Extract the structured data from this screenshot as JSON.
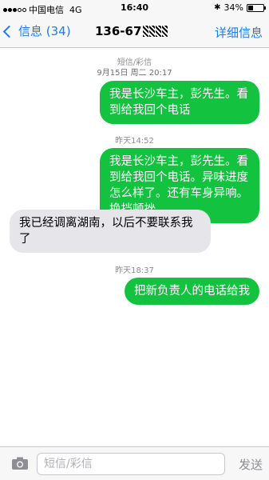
{
  "status_bar": {
    "carrier": "中国电信",
    "network": "4G",
    "time": "16:40",
    "battery": "34%",
    "battery_level": 0.34
  },
  "nav": {
    "back_label": "信息 (34)",
    "title": "136-67",
    "details_label": "详细信息"
  },
  "conversation": {
    "header_type": "短信/彩信",
    "header_date": "9月15日 周二 20:17",
    "messages": [
      {
        "text": "我是长沙车主，彭先生。看到给我回个电话"
      },
      {
        "timestamp_day": "昨天",
        "timestamp_time": "14:52"
      },
      {
        "text": "我是长沙车主，彭先生。看到给我回个电话。异味进度怎么样了。还有车身异响。换挡顿挫"
      },
      {
        "text": "我已经调离湖南，以后不要联系我了"
      },
      {
        "timestamp_day": "昨天",
        "timestamp_time": "18:37"
      },
      {
        "text": "把新负责人的电话给我"
      }
    ]
  },
  "input_bar": {
    "placeholder": "短信/彩信",
    "send_label": "发送"
  },
  "colors": {
    "accent": "#1a7cf5",
    "sent_bubble": "#13c23f",
    "received_bubble": "#e5e5ea"
  }
}
